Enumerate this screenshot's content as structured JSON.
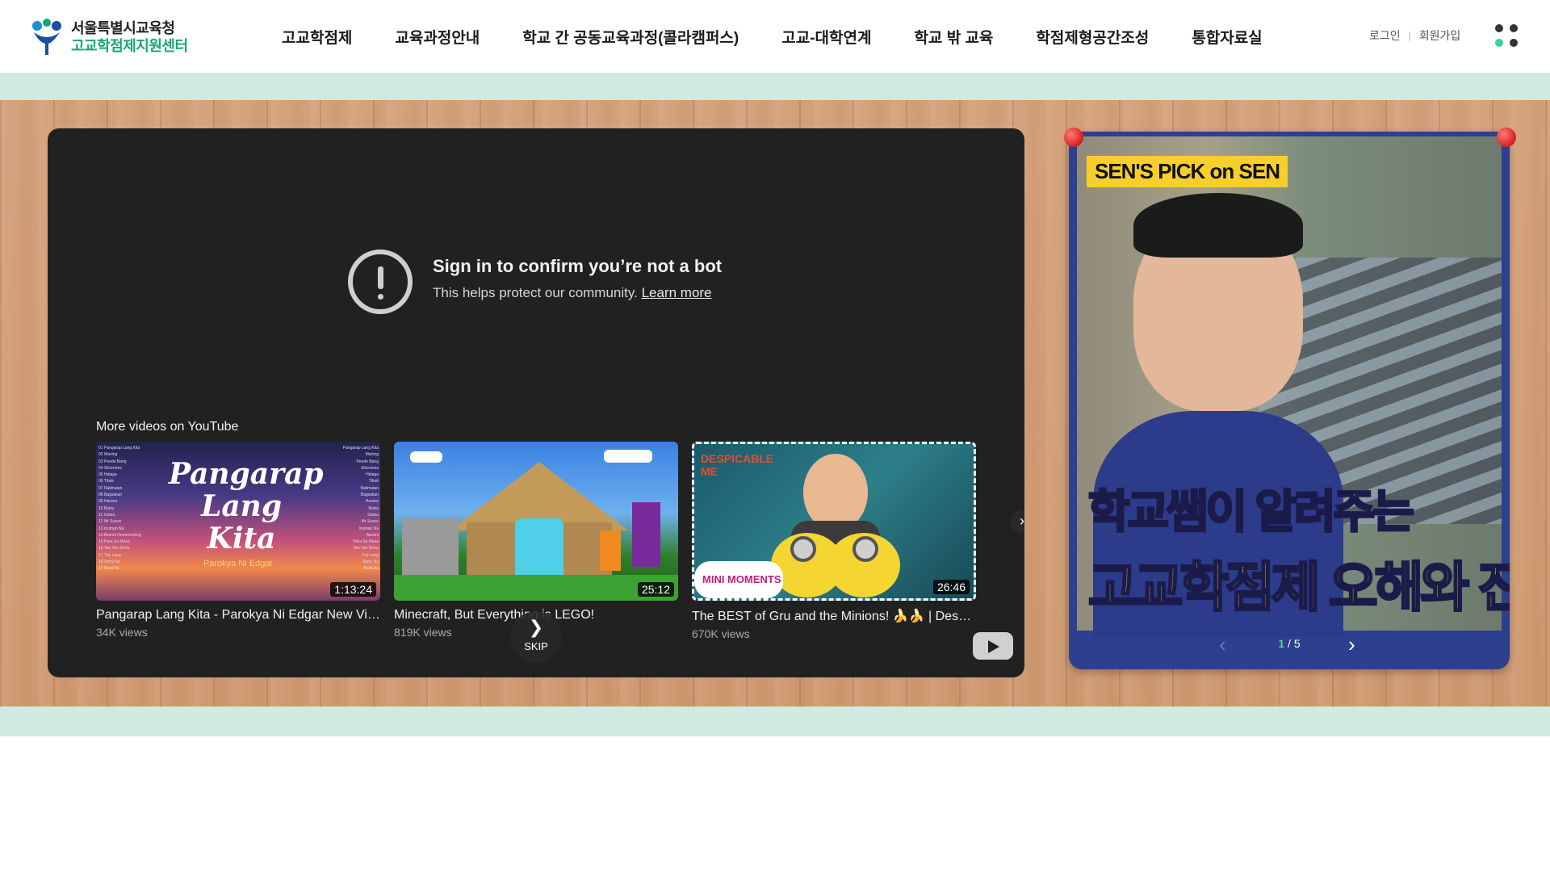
{
  "header": {
    "logo_line1": "서울특별시교육청",
    "logo_line2": "고교학점제지원센터",
    "nav": [
      {
        "label": "고교학점제"
      },
      {
        "label": "교육과정안내"
      },
      {
        "label": "학교 간 공동교육과정(콜라캠퍼스)"
      },
      {
        "label": "고교-대학연계"
      },
      {
        "label": "학교 밖 교육"
      },
      {
        "label": "학점제형공간조성"
      },
      {
        "label": "통합자료실"
      }
    ],
    "login": "로그인",
    "join": "회원가입",
    "divider": "|",
    "allmenu_icon": "all-menu-dots-icon"
  },
  "player": {
    "alert_title": "Sign in to confirm you’re not a bot",
    "alert_sub": "This helps protect our community.",
    "learn_more": "Learn more",
    "more_label": "More videos on YouTube",
    "videos": [
      {
        "title": "Pangarap Lang Kita - Parokya Ni Edgar New Viral OPM Hits Playlist",
        "views": "34K views",
        "duration": "1:13:24",
        "thumb_title": "Pangarap Lang Kita",
        "thumb_sub": "Parokya Ni Edgar"
      },
      {
        "title": "Minecraft, But Everything is LEGO!",
        "views": "819K views",
        "duration": "25:12"
      },
      {
        "title": "The BEST of Gru and the Minions! 🍌🍌 | Despicable Me",
        "views": "670K views",
        "duration": "26:46",
        "thumb_brand": "DESPICABLE ME",
        "thumb_tag": "MINI MOMENTS"
      }
    ],
    "skip_label": "SKIP",
    "skip_arrow": "❯",
    "next_arrow": "›"
  },
  "side": {
    "badge": "SEN'S PICK on SEN",
    "caption1": "학교쌤이 알려주는",
    "caption2": "고교학점제 오해와 진실",
    "page_current": "1",
    "page_sep": "/",
    "page_total": "5",
    "prev": "‹",
    "next": "›"
  },
  "colors": {
    "accent_green": "#17a673",
    "band_mint": "#cfeadf",
    "player_bg": "#212121",
    "side_blue": "#2d3f8f",
    "caption_yellow": "#f8d12e"
  }
}
